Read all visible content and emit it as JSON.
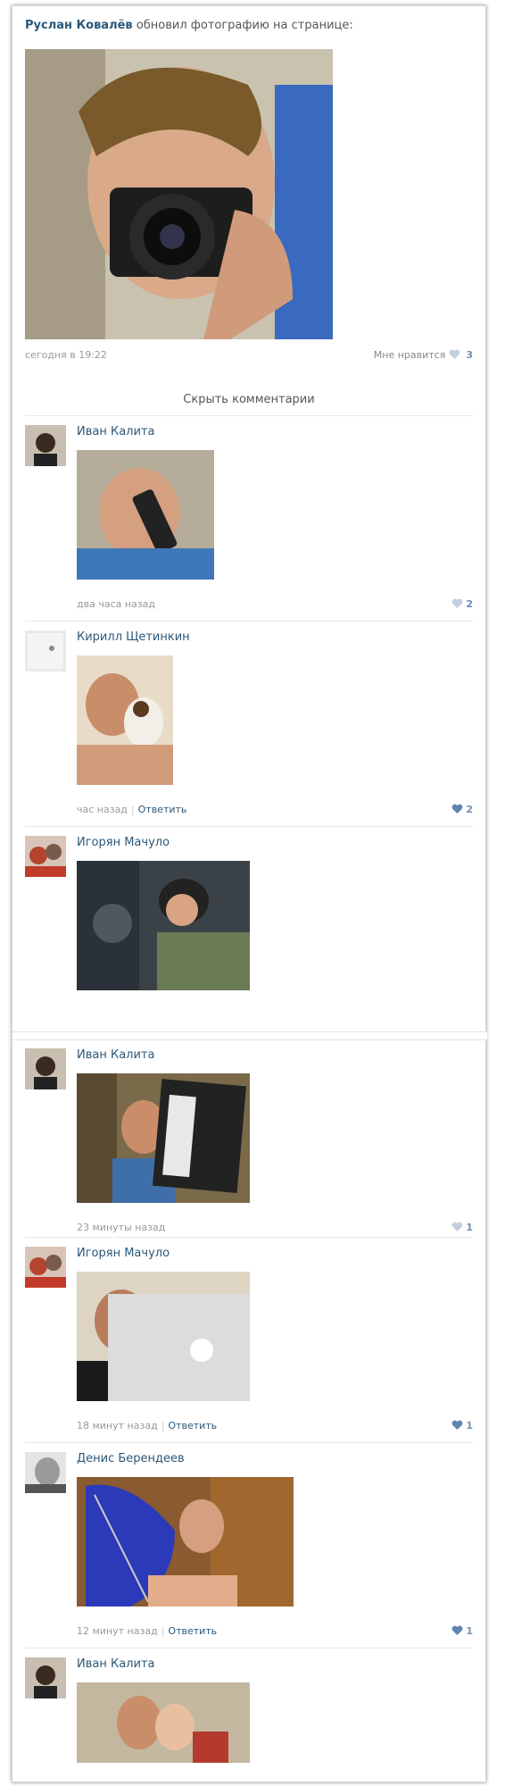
{
  "post": {
    "author": "Руслан Ковалёв",
    "action": "обновил фотографию на странице:",
    "time": "сегодня в 19:22",
    "like_label": "Мне нравится",
    "like_count": "3"
  },
  "hide_comments_label": "Скрыть комментарии",
  "reply_label": "Ответить",
  "comments": [
    {
      "name": "Иван Калита",
      "time": "два часа назад",
      "likes": "2"
    },
    {
      "name": "Кирилл Щетинкин",
      "time": "час назад",
      "likes": "2"
    },
    {
      "name": "Игорян Мачуло",
      "time": "",
      "likes": ""
    },
    {
      "name": "Иван Калита",
      "time": "23 минуты назад",
      "likes": "1"
    },
    {
      "name": "Игорян Мачуло",
      "time": "18 минут назад",
      "likes": "1"
    },
    {
      "name": "Денис Берендеев",
      "time": "12 минут назад",
      "likes": "1"
    },
    {
      "name": "Иван Калита",
      "time": "",
      "likes": ""
    }
  ],
  "colors": {
    "link": "#2b587a",
    "muted": "#999999",
    "like_blue": "#6d8fb3"
  }
}
